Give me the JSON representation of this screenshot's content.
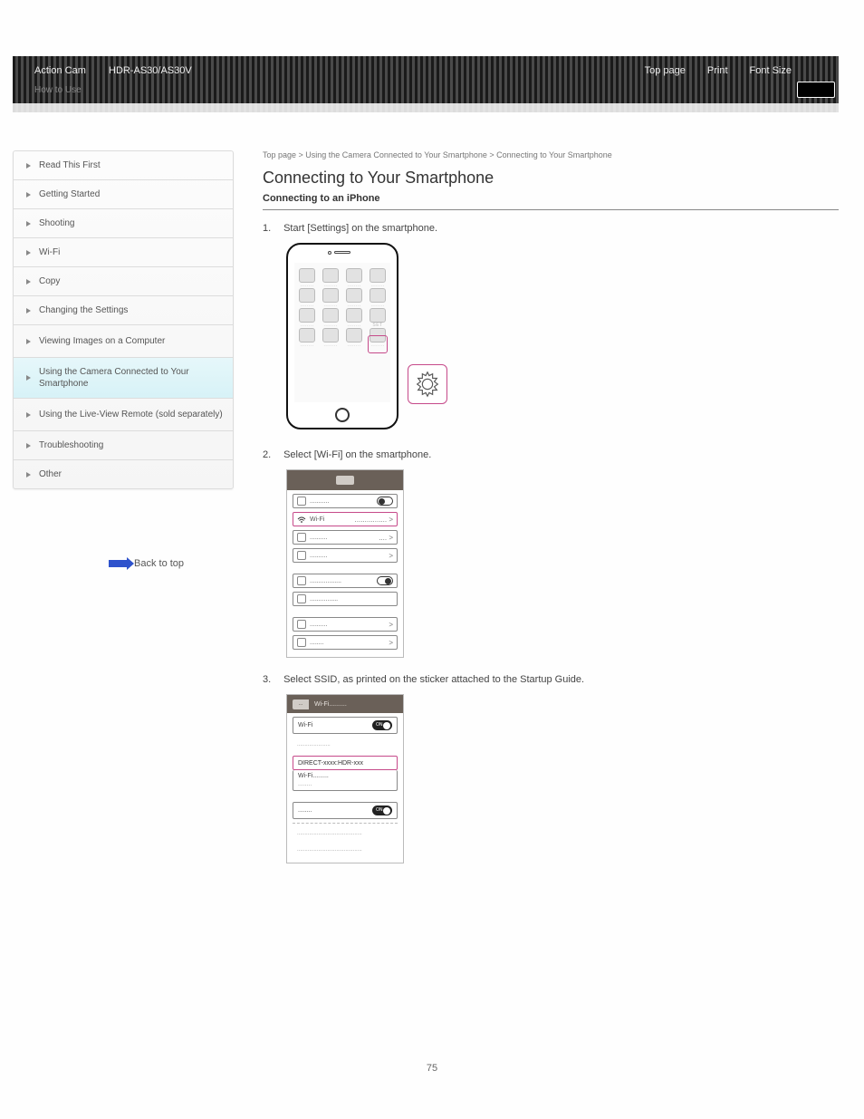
{
  "header": {
    "brand": "Action Cam",
    "model": "HDR-AS30/AS30V",
    "howto": "How to Use",
    "nav": [
      "Top page",
      "Print",
      "Font Size"
    ]
  },
  "sidebar": {
    "items": [
      {
        "label": "Read This First"
      },
      {
        "label": "Getting Started"
      },
      {
        "label": "Shooting"
      },
      {
        "label": "Wi-Fi"
      },
      {
        "label": "Copy"
      },
      {
        "label": "Changing the Settings"
      },
      {
        "label": "Viewing Images on a Computer"
      },
      {
        "label": "Using the Camera Connected to Your Smartphone"
      },
      {
        "label": "Using the Live-View Remote (sold separately)"
      },
      {
        "label": "Troubleshooting"
      },
      {
        "label": "Other"
      }
    ],
    "active_index": 7
  },
  "backtop": "Back to top",
  "main": {
    "breadcrumb": "Top page > Using the Camera Connected to Your Smartphone > Connecting to Your Smartphone",
    "title": "Connecting to Your Smartphone",
    "subtitle": "Connecting to an iPhone",
    "steps": [
      {
        "n": "1.",
        "t": "Start [Settings] on the smartphone."
      },
      {
        "n": "2.",
        "t": "Select [Wi-Fi] on the smartphone."
      },
      {
        "n": "3.",
        "t": "Select SSID, as printed on the sticker attached to the Startup Guide."
      }
    ],
    "panels": {
      "home_gear_label": "SET",
      "settings_rows": {
        "wifi_label": "Wi-Fi"
      },
      "wifi_screen": {
        "header_back": "...",
        "header": "Wi-Fi..........",
        "wifi_row": "Wi-Fi",
        "switch_on": "ON",
        "choose_msg": "......................",
        "ssid": "DIRECT-xxxx:HDR-xxx",
        "other_net": "Wi-Fi.........",
        "pw_line": "........"
      }
    }
  },
  "page_number": "75"
}
